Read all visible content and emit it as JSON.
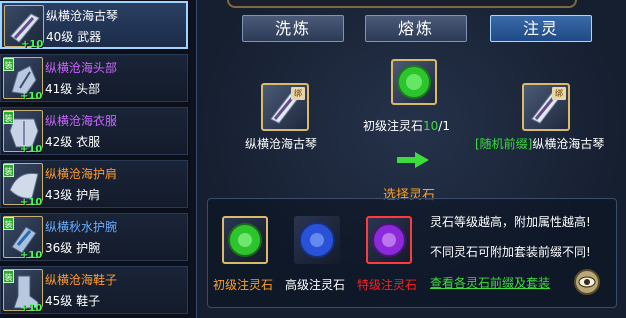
{
  "equipment_list": [
    {
      "name": "纵横沧海古琴",
      "level": "40级",
      "slot": "武器",
      "plus": "+10",
      "tag": "",
      "name_color": "#ffffff"
    },
    {
      "name": "纵横沧海头部",
      "level": "41级",
      "slot": "头部",
      "plus": "+10",
      "tag": "装",
      "name_color": "#cc66ff"
    },
    {
      "name": "纵横沧海衣服",
      "level": "42级",
      "slot": "衣服",
      "plus": "+10",
      "tag": "装",
      "name_color": "#cc66ff"
    },
    {
      "name": "纵横沧海护肩",
      "level": "43级",
      "slot": "护肩",
      "plus": "+10",
      "tag": "装",
      "name_color": "#ff9b2b"
    },
    {
      "name": "纵横秋水护腕",
      "level": "36级",
      "slot": "护腕",
      "plus": "+10",
      "tag": "装",
      "name_color": "#6aaeff"
    },
    {
      "name": "纵横沧海鞋子",
      "level": "45级",
      "slot": "鞋子",
      "plus": "+10",
      "tag": "装",
      "name_color": "#ff9b2b"
    }
  ],
  "tabs": [
    "洗炼",
    "熔炼",
    "注灵"
  ],
  "active_tab": "注灵",
  "source_item": {
    "name": "纵横沧海古琴",
    "bind_badge": "绑"
  },
  "required_stone": {
    "name": "初级注灵石",
    "have": "10",
    "need": "/1"
  },
  "result_item": {
    "prefix": "[随机前缀]",
    "name": "纵横沧海古琴",
    "bind_badge": "绑"
  },
  "select_title": "选择灵石",
  "stones": [
    {
      "name": "初级注灵石",
      "color": "#ffa020",
      "gem": "#2ec42e"
    },
    {
      "name": "高级注灵石",
      "color": "#ffffff",
      "gem": "#2a52d8"
    },
    {
      "name": "特级注灵石",
      "color": "#ff2020",
      "gem": "#8a2ad8"
    }
  ],
  "info_lines": [
    "灵石等级越高，附加属性越高!",
    "不同灵石可附加套装前缀不同!"
  ],
  "info_link": "查看各灵石前缀及套装",
  "icons": {
    "view": "eye-icon",
    "arrow": "arrow-right-icon"
  },
  "colors": {
    "accent_green": "#3cdc3c",
    "title_orange": "#ffa020",
    "link_green": "#3cdc3c",
    "count_green": "#3cdc3c"
  }
}
